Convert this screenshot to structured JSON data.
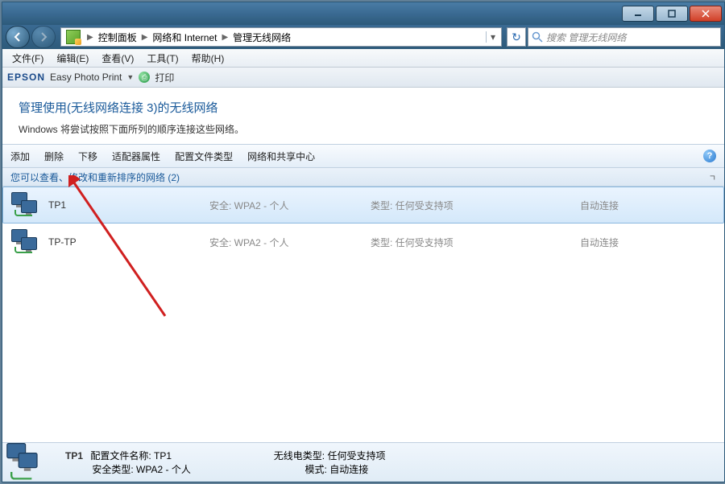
{
  "breadcrumb": {
    "items": [
      "控制面板",
      "网络和 Internet",
      "管理无线网络"
    ]
  },
  "search": {
    "placeholder": "搜索 管理无线网络"
  },
  "menubar": [
    "文件(F)",
    "编辑(E)",
    "查看(V)",
    "工具(T)",
    "帮助(H)"
  ],
  "epson": {
    "brand": "EPSON",
    "text": "Easy Photo Print",
    "print": "打印"
  },
  "header": {
    "title": "管理使用(无线网络连接 3)的无线网络",
    "subtitle": "Windows 将尝试按照下面所列的顺序连接这些网络。"
  },
  "toolbar": {
    "add": "添加",
    "remove": "删除",
    "movedown": "下移",
    "adapter": "适配器属性",
    "profile": "配置文件类型",
    "center": "网络和共享中心"
  },
  "group": {
    "label": "您可以查看、修改和重新排序的网络 (2)"
  },
  "columns": {
    "sec_prefix": "安全:",
    "type_prefix": "类型:",
    "conn_auto": "自动连接"
  },
  "networks": [
    {
      "name": "TP1",
      "security": "WPA2 - 个人",
      "type": "任何受支持项",
      "connect": "自动连接",
      "selected": true
    },
    {
      "name": "TP-TP",
      "security": "WPA2 - 个人",
      "type": "任何受支持项",
      "connect": "自动连接",
      "selected": false
    }
  ],
  "details": {
    "name": "TP1",
    "profile_label": "配置文件名称:",
    "profile_value": "TP1",
    "sectype_label": "安全类型:",
    "sectype_value": "WPA2 - 个人",
    "radio_label": "无线电类型:",
    "radio_value": "任何受支持项",
    "mode_label": "模式:",
    "mode_value": "自动连接"
  }
}
